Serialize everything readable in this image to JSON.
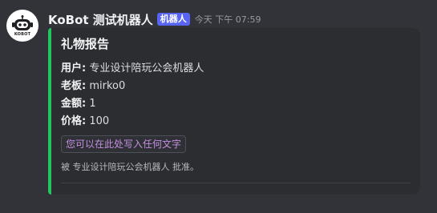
{
  "message": {
    "author": {
      "name": "KoBot 测试机器人",
      "bot_tag": "机器人",
      "avatar_text": "KOBOT",
      "avatar_icon": "robot-icon"
    },
    "timestamp": "今天 下午 07:59"
  },
  "embed": {
    "accent_color": "#23c55e",
    "title": "礼物报告",
    "fields": [
      {
        "key": "用户:",
        "value": "专业设计陪玩公会机器人"
      },
      {
        "key": "老板:",
        "value": "mirko0"
      },
      {
        "key": "金额:",
        "value": "1"
      },
      {
        "key": "价格:",
        "value": "100"
      }
    ],
    "code_text": "您可以在此处写入任何文字",
    "footer": "被 专业设计陪玩公会机器人 批准。"
  },
  "colors": {
    "background": "#313338",
    "embed_background": "#2b2d31",
    "bot_tag": "#5865f2",
    "code_text": "#c48fe0"
  }
}
